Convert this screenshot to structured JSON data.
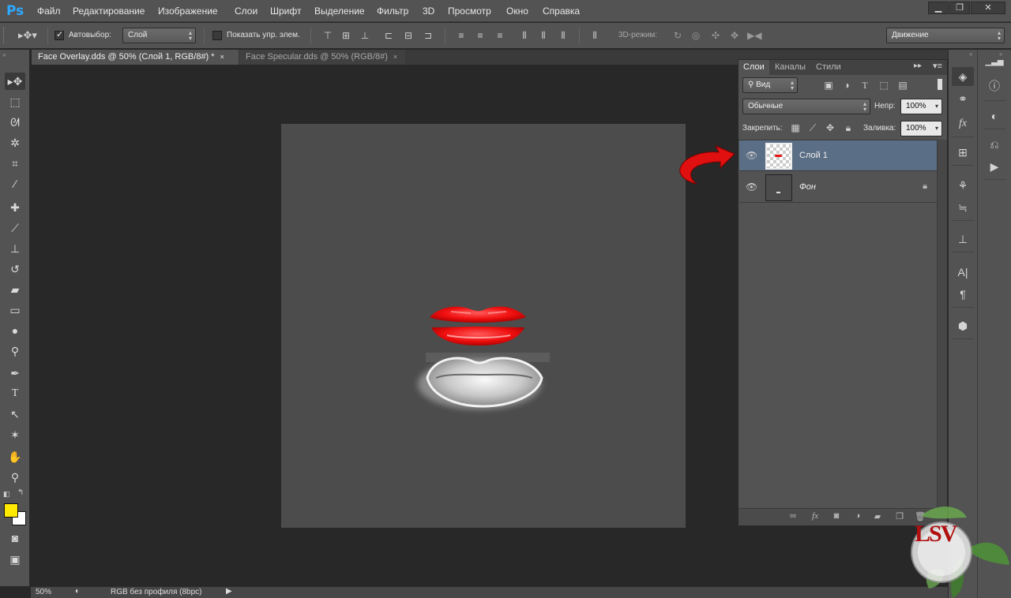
{
  "app": {
    "logo": "Ps"
  },
  "menu": [
    "Файл",
    "Редактирование",
    "Изображение",
    "Слои",
    "Шрифт",
    "Выделение",
    "Фильтр",
    "3D",
    "Просмотр",
    "Окно",
    "Справка"
  ],
  "window_controls": {
    "minimize": "▁",
    "restore": "❐",
    "close": "✕"
  },
  "options": {
    "autoselect_label": "Автовыбор:",
    "autoselect_checked": true,
    "autoselect_value": "Слой",
    "show_controls_label": "Показать упр. элем.",
    "show_controls_checked": false,
    "mode3d_label": "3D-режим:",
    "workspace_value": "Движение"
  },
  "tabs": [
    {
      "label": "Face Overlay.dds @ 50% (Слой 1, RGB/8#) *",
      "active": true
    },
    {
      "label": "Face Specular.dds @ 50% (RGB/8#)",
      "active": false
    }
  ],
  "tab_close": "×",
  "statusbar": {
    "zoom": "50%",
    "profile": "RGB без профиля (8bpc)"
  },
  "layers_panel": {
    "tabs": [
      "Слои",
      "Каналы",
      "Стили"
    ],
    "filter_value": "Вид",
    "blend_mode": "Обычные",
    "opacity_label": "Непр:",
    "opacity_value": "100%",
    "lock_label": "Закрепить:",
    "fill_label": "Заливка:",
    "fill_value": "100%",
    "layers": [
      {
        "name": "Слой 1",
        "selected": true,
        "visible": true,
        "locked": false
      },
      {
        "name": "Фон",
        "selected": false,
        "visible": true,
        "locked": true
      }
    ]
  },
  "watermark": {
    "text": "LSV"
  },
  "colors": {
    "foreground": "#ffea00",
    "background": "#ffffff",
    "selection": "#5a6e85",
    "arrow": "#e01010",
    "lips_red": "#ff1414"
  }
}
